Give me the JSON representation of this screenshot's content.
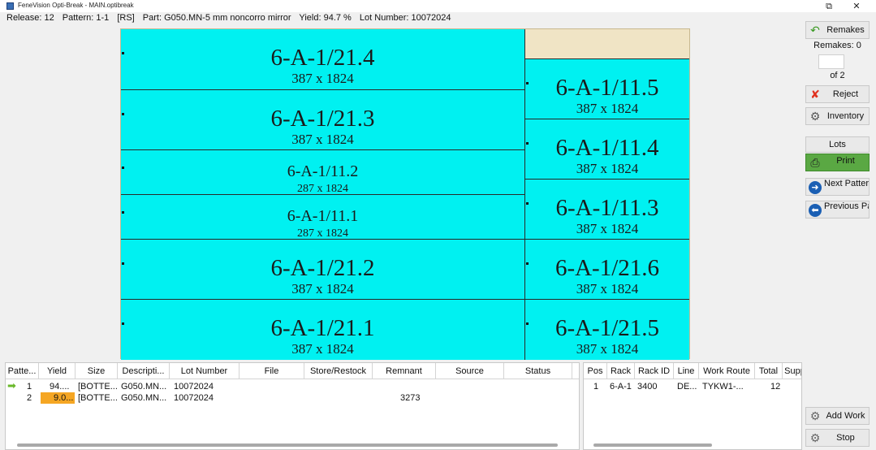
{
  "window": {
    "title": "FeneVision Opti-Break - MAIN.optibreak",
    "restore_glyph": "⧉",
    "close_glyph": "✕"
  },
  "info": {
    "release": "Release: 12",
    "pattern": "Pattern: 1-1",
    "rs": "[RS]",
    "part": "Part: G050.MN-5 mm noncorro mirror",
    "yield": "Yield: 94.7 %",
    "lot": "Lot Number: 10072024"
  },
  "pieces": {
    "left": [
      {
        "id": "6-A-1/21.4",
        "dim": "387 x 1824"
      },
      {
        "id": "6-A-1/21.3",
        "dim": "387 x 1824"
      },
      {
        "id": "6-A-1/11.2",
        "dim": "287 x 1824"
      },
      {
        "id": "6-A-1/11.1",
        "dim": "287 x 1824"
      },
      {
        "id": "6-A-1/21.2",
        "dim": "387 x 1824"
      },
      {
        "id": "6-A-1/21.1",
        "dim": "387 x 1824"
      }
    ],
    "right": [
      {
        "id": "6-A-1/11.5",
        "dim": "387 x 1824"
      },
      {
        "id": "6-A-1/11.4",
        "dim": "387 x 1824"
      },
      {
        "id": "6-A-1/11.3",
        "dim": "387 x 1824"
      },
      {
        "id": "6-A-1/21.6",
        "dim": "387 x 1824"
      },
      {
        "id": "6-A-1/21.5",
        "dim": "387 x 1824"
      }
    ]
  },
  "sidebar": {
    "remakes_label": "Remakes",
    "remakes_count": "Remakes: 0",
    "of_pages": "of 2",
    "reject_label": "Reject",
    "inventory_label": "Inventory",
    "lots_label": "Lots",
    "print_label": "Print",
    "next_label": "Next Pattern",
    "previous_label": "Previous Pattern",
    "add_work_label": "Add Work",
    "stop_label": "Stop"
  },
  "patterns_table": {
    "headers": [
      "Patte...",
      "Yield",
      "Size",
      "Descripti...",
      "Lot Number",
      "File",
      "Store/Restock",
      "Remnant",
      "Source",
      "Status"
    ],
    "rows": [
      {
        "pattern": "1",
        "yield": "94....",
        "size": "[BOTTE...",
        "description": "G050.MN...",
        "lot": "10072024",
        "remnant": ""
      },
      {
        "pattern": "2",
        "yield": "9.0...",
        "size": "[BOTTE...",
        "description": "G050.MN...",
        "lot": "10072024",
        "remnant": "3273"
      }
    ]
  },
  "racks_table": {
    "headers": [
      "Pos",
      "Rack",
      "Rack ID",
      "Line",
      "Work Route",
      "Total",
      "Supp"
    ],
    "rows": [
      {
        "pos": "1",
        "rack": "6-A-1",
        "rack_id": "3400",
        "line": "DE...",
        "work_route": "TYKW1-...",
        "total": "12"
      }
    ]
  },
  "colors": {
    "piece": "#00f1f1",
    "sheet": "#f0e4c5",
    "yield_low": "#f5a623",
    "current_arrow": "#6ab82b"
  }
}
